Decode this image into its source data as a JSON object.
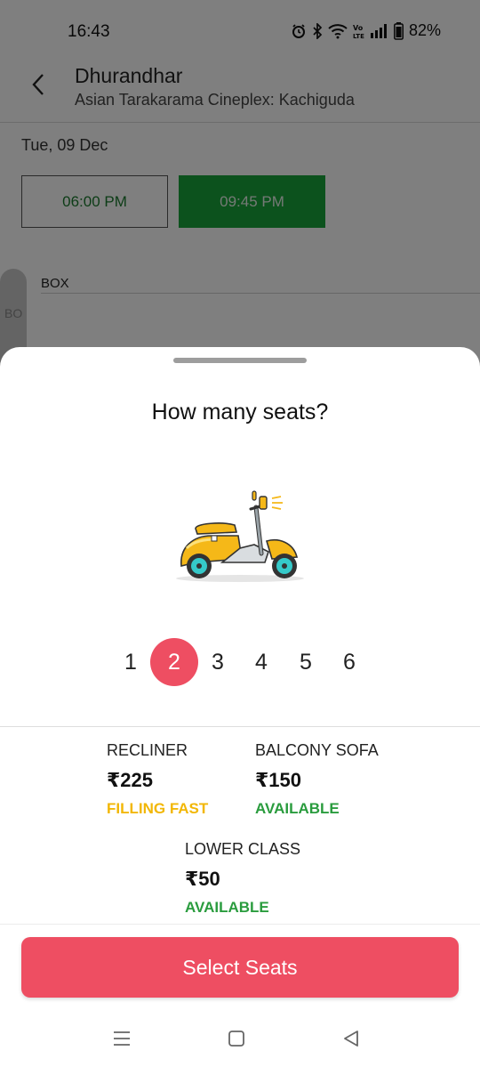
{
  "status_bar": {
    "time": "16:43",
    "battery": "82%"
  },
  "header": {
    "title": "Dhurandhar",
    "subtitle": "Asian Tarakarama Cineplex: Kachiguda"
  },
  "date": "Tue, 09 Dec",
  "showtimes": [
    {
      "label": "06:00 PM"
    },
    {
      "label": "09:45 PM"
    }
  ],
  "seat_map": {
    "section_label": "BOX",
    "side_label": "BO"
  },
  "sheet": {
    "title": "How many seats?",
    "illustration": "scooter",
    "counts": [
      "1",
      "2",
      "3",
      "4",
      "5",
      "6"
    ],
    "selected_count": "2",
    "tiers": [
      {
        "name": "RECLINER",
        "price": "₹225",
        "status": "FILLING FAST"
      },
      {
        "name": "BALCONY SOFA",
        "price": "₹150",
        "status": "AVAILABLE"
      },
      {
        "name": "LOWER CLASS",
        "price": "₹50",
        "status": "AVAILABLE"
      }
    ],
    "button_label": "Select Seats"
  },
  "colors": {
    "accent": "#ee4e62",
    "green": "#18a53a",
    "filling_fast": "#f2b705",
    "available": "#2a9c3e"
  }
}
